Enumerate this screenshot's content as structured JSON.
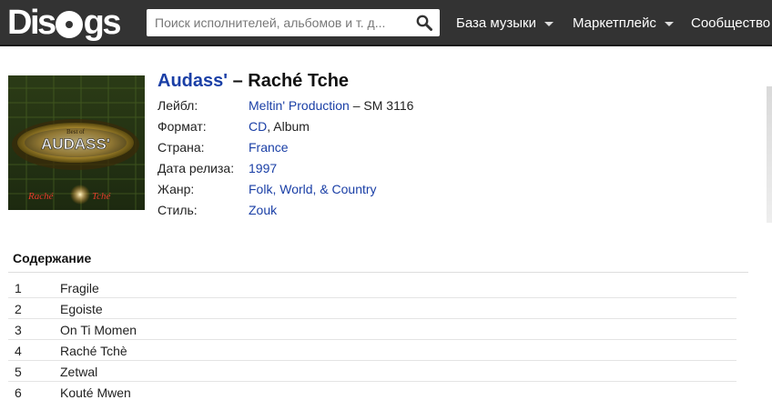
{
  "header": {
    "logo_text": "Discogs",
    "search_placeholder": "Поиск исполнителей, альбомов и т. д...",
    "nav": [
      {
        "label": "База музыки",
        "has_dropdown": true
      },
      {
        "label": "Маркетплейс",
        "has_dropdown": true
      },
      {
        "label": "Сообщество",
        "has_dropdown": false
      }
    ],
    "colors": {
      "bar": "#333333",
      "link": "#1a3fa6"
    }
  },
  "release": {
    "artist": "Audass'",
    "separator": " – ",
    "title": "Raché Tche",
    "cover": {
      "top_text": "Best of",
      "logo_text": "AUDASS'",
      "bottom_left": "Raché",
      "bottom_right": "Tché"
    },
    "info": [
      {
        "label": "Лейбл:",
        "link": "Meltin' Production",
        "text": " – SM 3116"
      },
      {
        "label": "Формат:",
        "link": "CD",
        "text": ", Album"
      },
      {
        "label": "Страна:",
        "link": "France",
        "text": ""
      },
      {
        "label": "Дата релиза:",
        "link": "1997",
        "text": ""
      },
      {
        "label": "Жанр:",
        "link": "Folk, World, & Country",
        "text": ""
      },
      {
        "label": "Стиль:",
        "link": "Zouk",
        "text": ""
      }
    ]
  },
  "tracklist": {
    "heading": "Содержание",
    "tracks": [
      {
        "pos": "1",
        "title": "Fragile"
      },
      {
        "pos": "2",
        "title": "Egoiste"
      },
      {
        "pos": "3",
        "title": "On Ti Momen"
      },
      {
        "pos": "4",
        "title": "Raché Tchè"
      },
      {
        "pos": "5",
        "title": "Zetwal"
      },
      {
        "pos": "6",
        "title": "Kouté Mwen"
      }
    ]
  }
}
